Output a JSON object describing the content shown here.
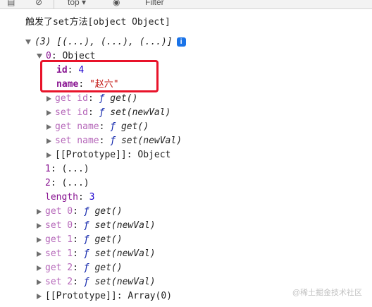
{
  "toolbar": {
    "context": "top",
    "filter_placeholder": "Filter"
  },
  "log_message": "触发了set方法[object Object]",
  "array_preview": "(3) [(...), (...), (...)]",
  "info_badge": "i",
  "item0": {
    "index": "0",
    "type": "Object"
  },
  "props": {
    "id_key": "id",
    "id_value": "4",
    "name_key": "name",
    "name_value": "\"赵六\""
  },
  "accessors": [
    {
      "label": "get id",
      "func": "get()"
    },
    {
      "label": "set id",
      "func": "set(newVal)"
    },
    {
      "label": "get name",
      "func": "get()"
    },
    {
      "label": "set name",
      "func": "set(newVal)"
    }
  ],
  "proto_key": "[[Prototype]]",
  "proto_object": "Object",
  "item1": {
    "index": "1",
    "value": "(...)"
  },
  "item2": {
    "index": "2",
    "value": "(...)"
  },
  "length": {
    "key": "length",
    "value": "3"
  },
  "array_accessors": [
    {
      "label": "get 0",
      "func": "get()"
    },
    {
      "label": "set 0",
      "func": "set(newVal)"
    },
    {
      "label": "get 1",
      "func": "get()"
    },
    {
      "label": "set 1",
      "func": "set(newVal)"
    },
    {
      "label": "get 2",
      "func": "get()"
    },
    {
      "label": "set 2",
      "func": "set(newVal)"
    }
  ],
  "array_proto": "Array(0)",
  "f_symbol": "ƒ",
  "watermark": "@稀土掘金技术社区"
}
